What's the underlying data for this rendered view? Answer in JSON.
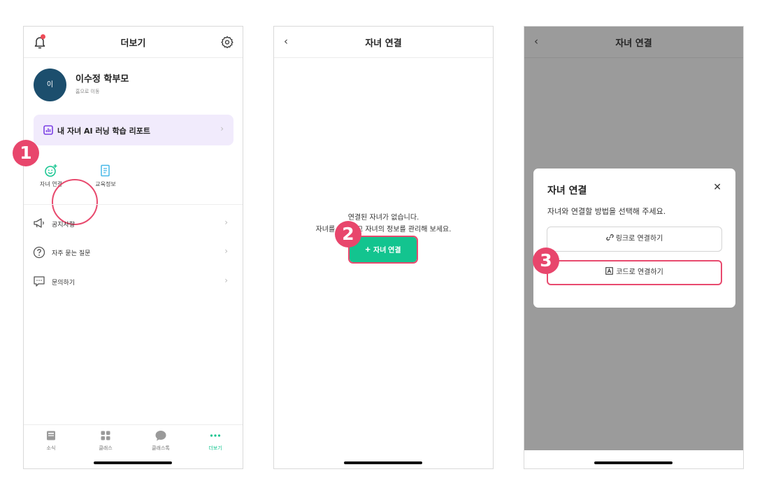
{
  "screen1": {
    "title": "더보기",
    "profile": {
      "avatar_letter": "이",
      "name": "이수정 학부모",
      "subtext": "홈으로 이동"
    },
    "report_banner": "내 자녀 AI 러닝 학습 리포트",
    "quick": [
      {
        "label": "자녀 연결",
        "icon": "smiley-plus-icon"
      },
      {
        "label": "교육정보",
        "icon": "document-icon"
      }
    ],
    "menu": [
      {
        "label": "공지사항",
        "icon": "megaphone-icon"
      },
      {
        "label": "자주 묻는 질문",
        "icon": "question-circle-icon"
      },
      {
        "label": "문의하기",
        "icon": "chat-dots-icon"
      }
    ],
    "tabs": [
      {
        "label": "소식",
        "icon": "news-icon"
      },
      {
        "label": "클래스",
        "icon": "grid-icon"
      },
      {
        "label": "클래스톡",
        "icon": "chat-bubble-icon"
      },
      {
        "label": "더보기",
        "icon": "more-dots-icon",
        "active": true
      }
    ]
  },
  "screen2": {
    "title": "자녀 연결",
    "empty_line1": "연결된 자녀가 없습니다.",
    "empty_line2": "자녀를 연결하고 자녀의 정보를 관리해 보세요.",
    "add_button": "자녀 연결"
  },
  "screen3": {
    "title": "자녀 연결",
    "modal": {
      "title": "자녀 연결",
      "subtitle": "자녀와 연결할 방법을 선택해 주세요.",
      "link_button": "링크로 연결하기",
      "code_button": "코드로 연결하기"
    }
  },
  "steps": [
    "1",
    "2",
    "3"
  ],
  "colors": {
    "accent_green": "#13c48f",
    "highlight_red": "#e84a6e",
    "avatar_navy": "#1c4e6d",
    "banner_lavender": "#f1ebfc",
    "overlay_gray": "#9b9b9b"
  }
}
